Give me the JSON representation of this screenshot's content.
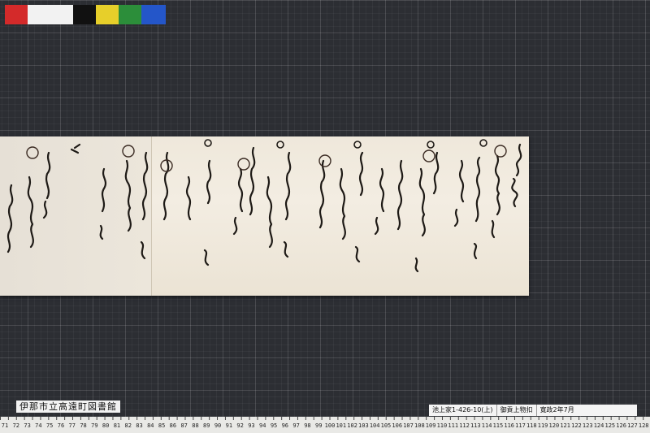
{
  "color_patches": [
    "#d42a2a",
    "#f2f2f2",
    "#111111",
    "#e7cf2a",
    "#2c8e3a",
    "#2456c9"
  ],
  "labels": {
    "library": "伊那市立高遠町図書館",
    "catalog_id": "池上家1-426-10(上)",
    "title": "御貢上物扣",
    "date": "寛政2年7月"
  },
  "ruler": {
    "ticks": [
      "71",
      "72",
      "73",
      "74",
      "75",
      "76",
      "77",
      "78",
      "79",
      "80",
      "81",
      "82",
      "83",
      "84",
      "85",
      "86",
      "87",
      "88",
      "89",
      "90",
      "91",
      "92",
      "93",
      "94",
      "95",
      "96",
      "97",
      "98",
      "99",
      "100",
      "101",
      "102",
      "103",
      "104",
      "105",
      "106",
      "107",
      "108",
      "109",
      "110",
      "111",
      "112",
      "113",
      "114",
      "115",
      "116",
      "117",
      "118",
      "119",
      "120",
      "121",
      "122",
      "123",
      "124",
      "125",
      "126",
      "127",
      "128"
    ]
  }
}
